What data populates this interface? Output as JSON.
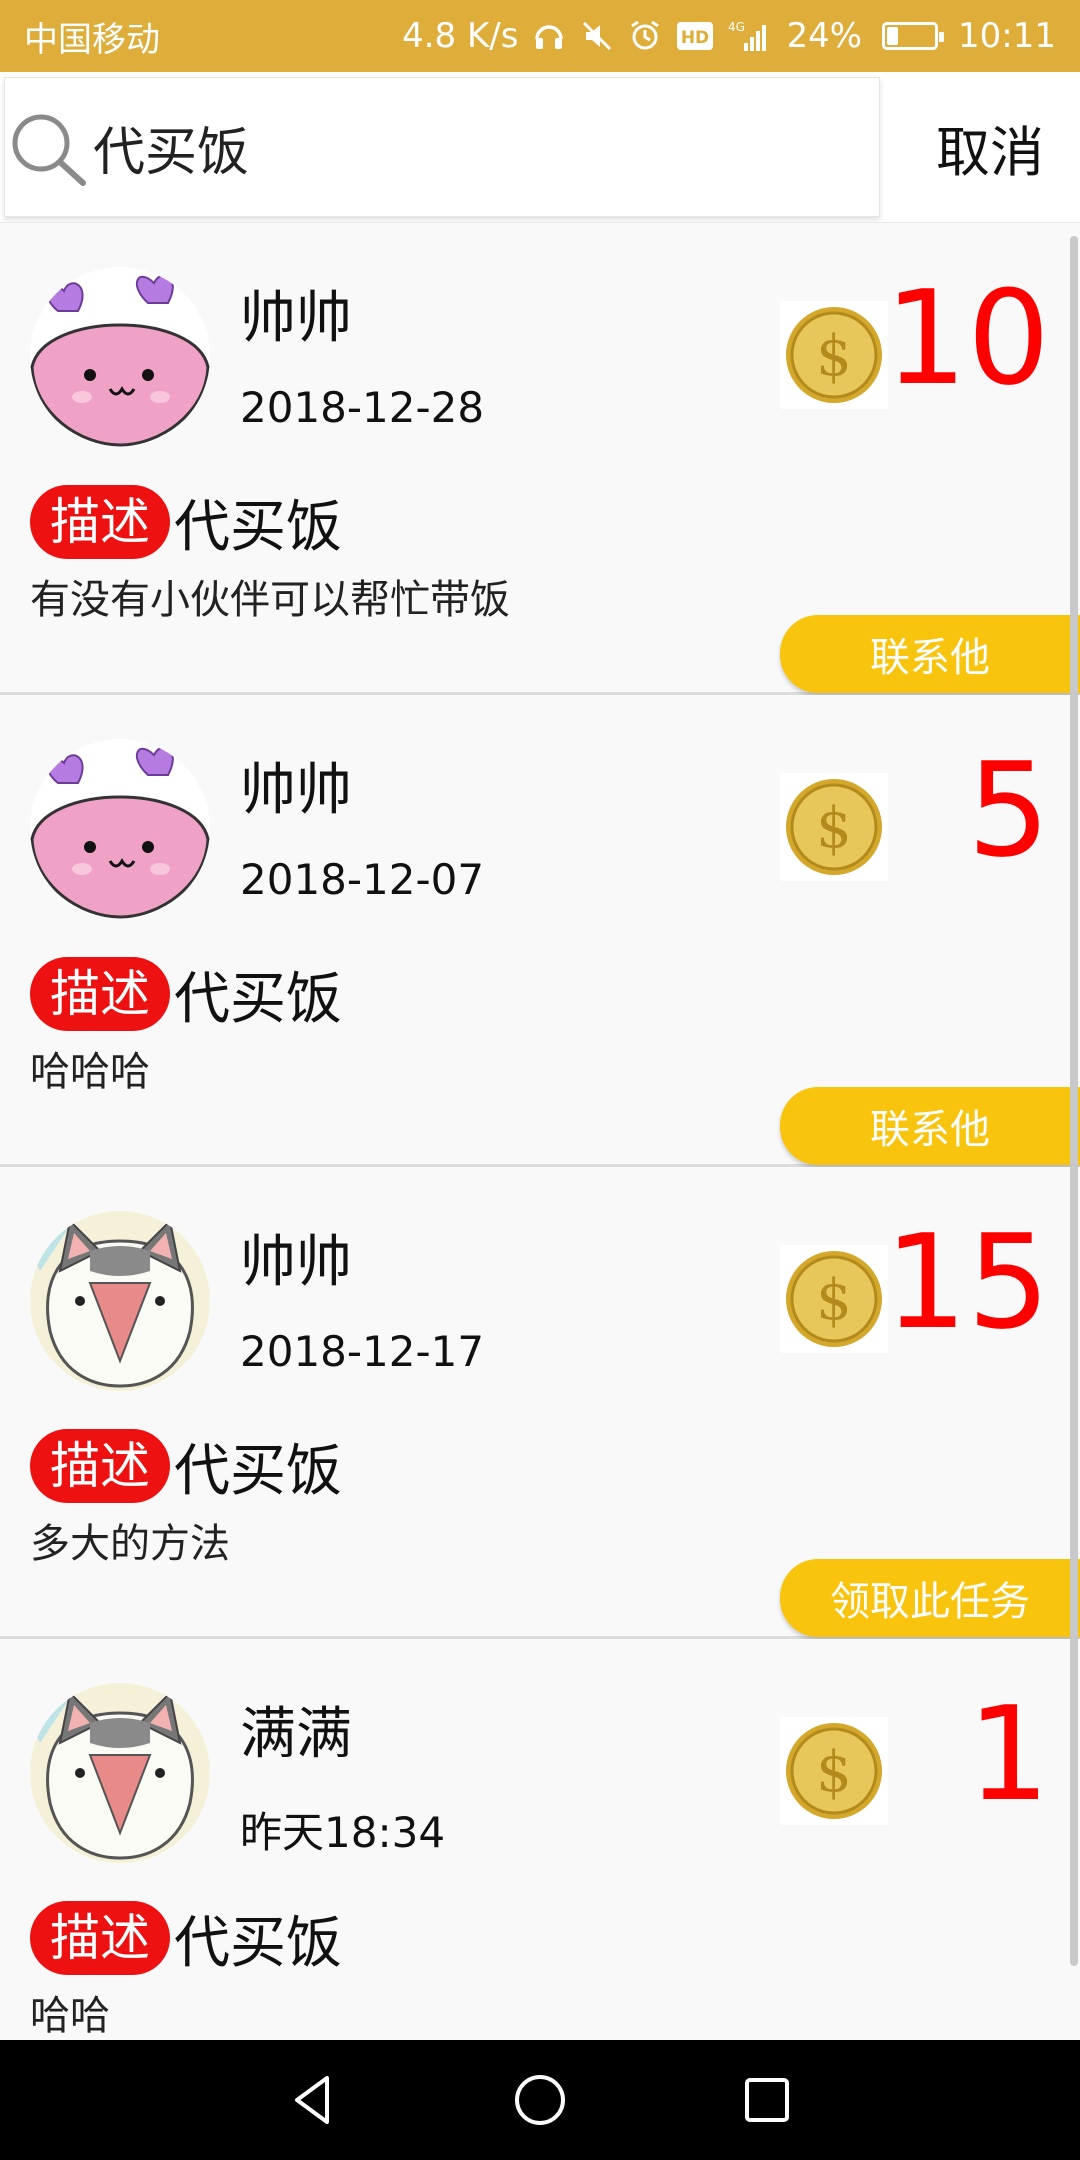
{
  "status_bar": {
    "carrier": "中国移动",
    "speed": "4.8 K/s",
    "hd": "HD",
    "network": "4G",
    "battery": "24%",
    "battery_level": 0.24,
    "time": "10:11"
  },
  "search": {
    "query": "代买饭",
    "cancel_label": "取消"
  },
  "tasks": [
    {
      "name": "帅帅",
      "date": "2018-12-28",
      "reward": "10",
      "tag": "描述",
      "title": "代买饭",
      "detail": "有没有小伙伴可以帮忙带饭",
      "action": "联系他",
      "avatar": "pink-bunny-avatar"
    },
    {
      "name": "帅帅",
      "date": "2018-12-07",
      "reward": "5",
      "tag": "描述",
      "title": "代买饭",
      "detail": "哈哈哈",
      "action": "联系他",
      "avatar": "pink-bunny-avatar"
    },
    {
      "name": "帅帅",
      "date": "2018-12-17",
      "reward": "15",
      "tag": "描述",
      "title": "代买饭",
      "detail": "多大的方法",
      "action": "领取此任务",
      "avatar": "cat-avatar"
    },
    {
      "name": "满满",
      "date": "昨天18:34",
      "reward": "1",
      "tag": "描述",
      "title": "代买饭",
      "detail": "哈哈",
      "action": "",
      "avatar": "cat-avatar"
    }
  ],
  "colors": {
    "status_bar": "#dfad39",
    "reward": "#ff0000",
    "tag": "#ee1111",
    "action_button": "#f9c40d"
  }
}
